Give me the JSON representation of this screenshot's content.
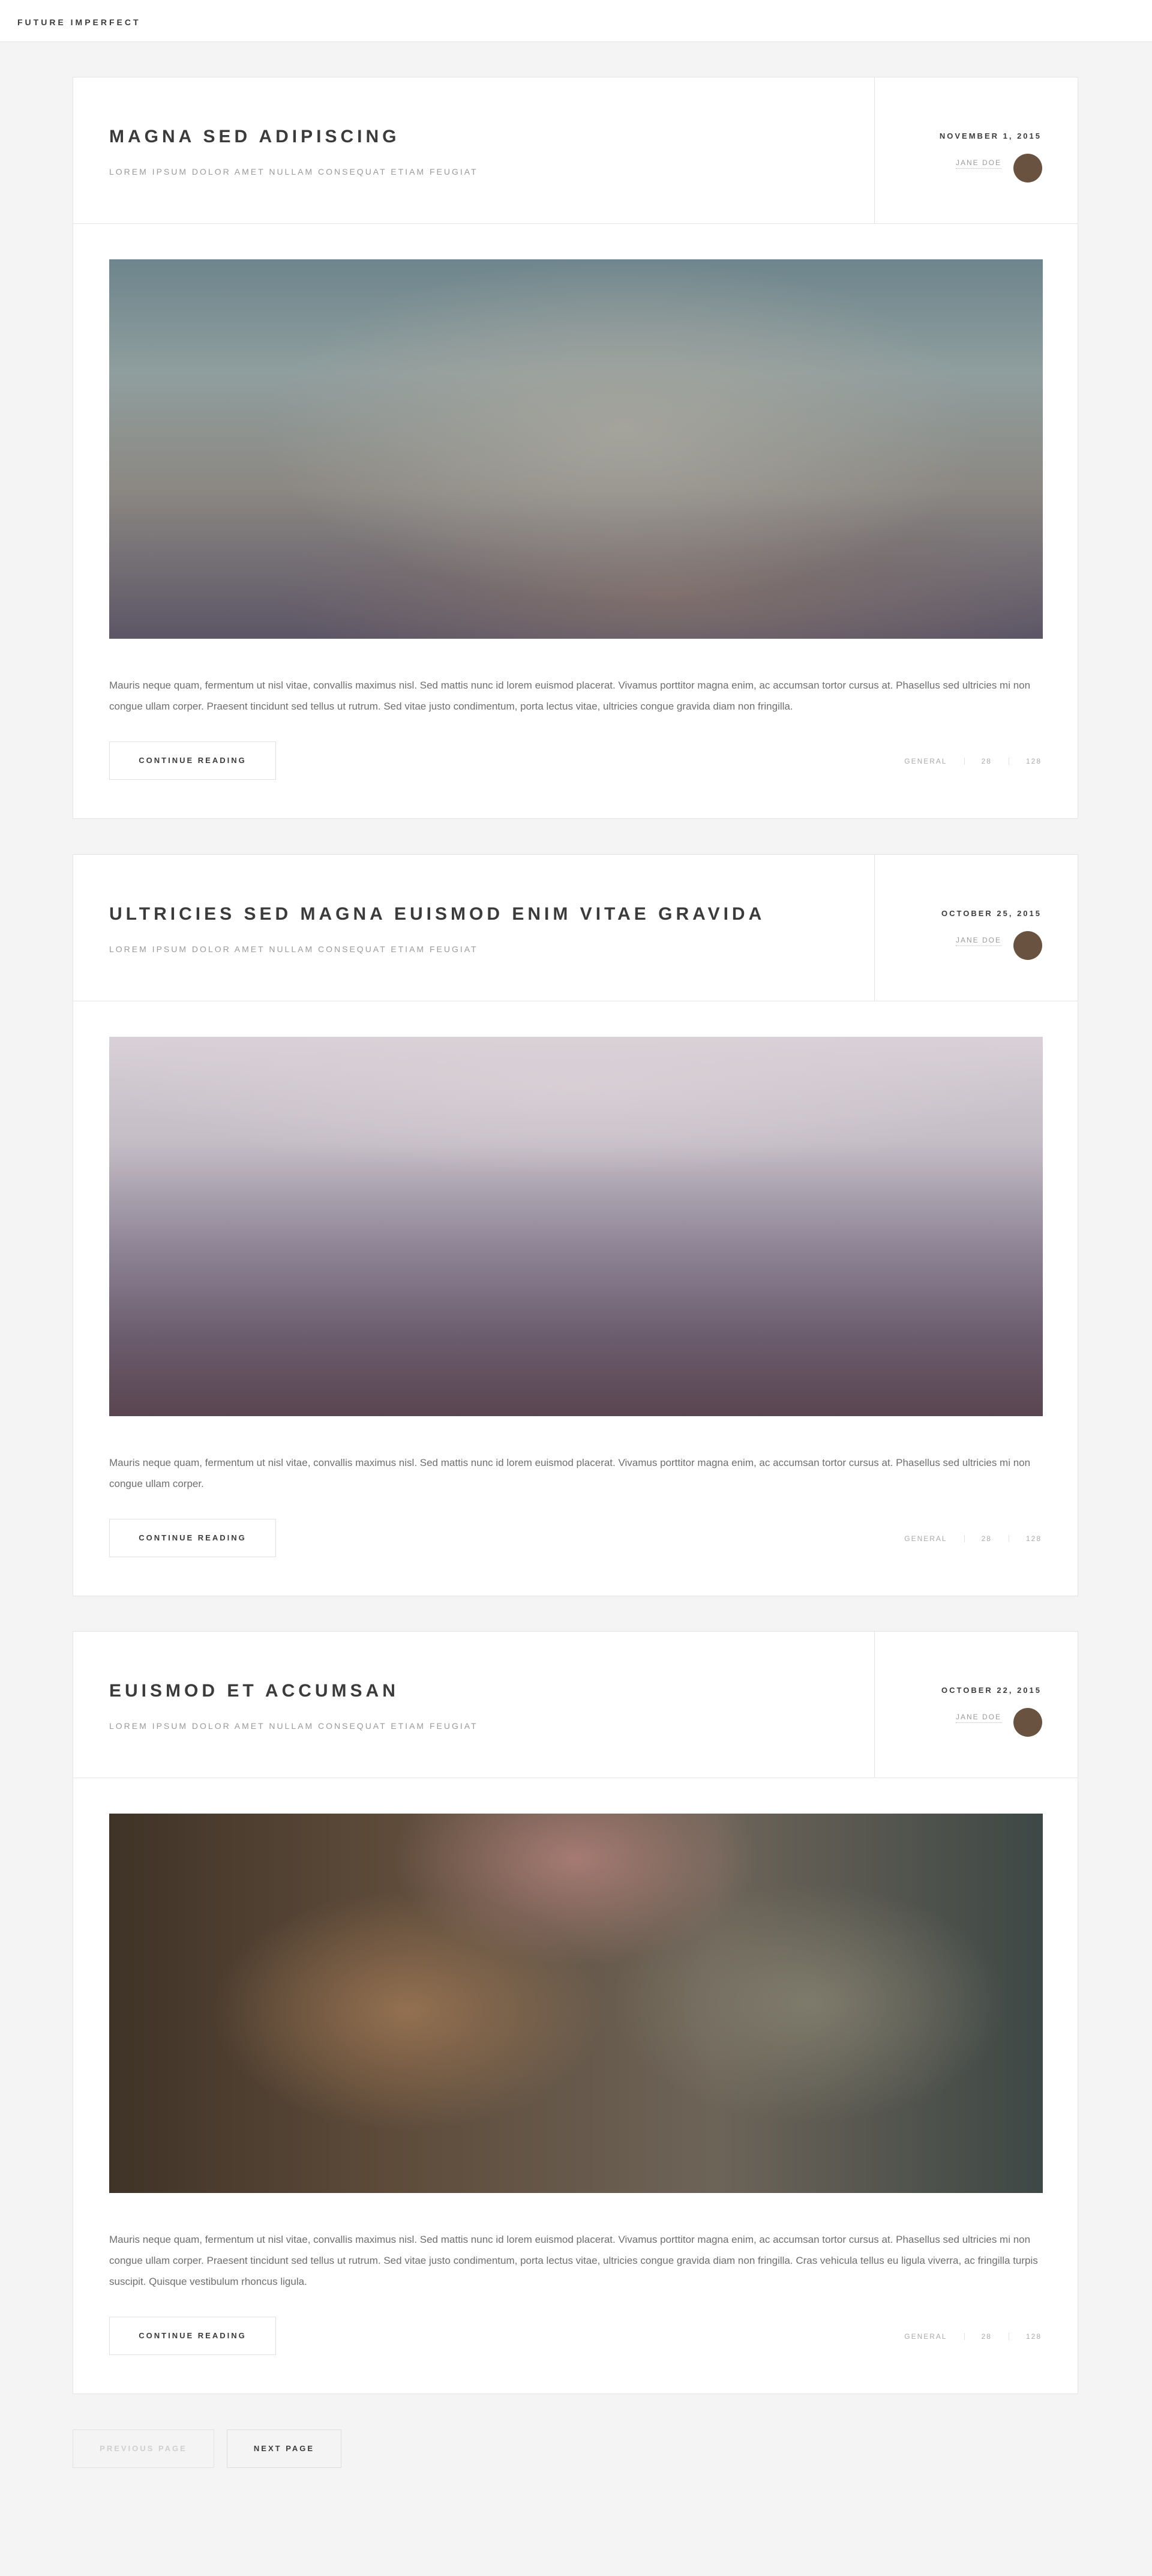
{
  "site": {
    "title": "FUTURE IMPERFECT"
  },
  "posts": [
    {
      "title": "MAGNA SED ADIPISCING",
      "subtitle": "LOREM IPSUM DOLOR AMET NULLAM CONSEQUAT ETIAM FEUGIAT",
      "date": "NOVEMBER 1, 2015",
      "author": "JANE DOE",
      "excerpt": "Mauris neque quam, fermentum ut nisl vitae, convallis maximus nisl. Sed mattis nunc id lorem euismod placerat. Vivamus porttitor magna enim, ac accumsan tortor cursus at. Phasellus sed ultricies mi non congue ullam corper. Praesent tincidunt sed tellus ut rutrum. Sed vitae justo condimentum, porta lectus vitae, ultricies congue gravida diam non fringilla.",
      "continue_label": "CONTINUE READING",
      "category": "GENERAL",
      "likes": "28",
      "comments": "128"
    },
    {
      "title": "ULTRICIES SED MAGNA EUISMOD ENIM VITAE GRAVIDA",
      "subtitle": "LOREM IPSUM DOLOR AMET NULLAM CONSEQUAT ETIAM FEUGIAT",
      "date": "OCTOBER 25, 2015",
      "author": "JANE DOE",
      "excerpt": "Mauris neque quam, fermentum ut nisl vitae, convallis maximus nisl. Sed mattis nunc id lorem euismod placerat. Vivamus porttitor magna enim, ac accumsan tortor cursus at. Phasellus sed ultricies mi non congue ullam corper.",
      "continue_label": "CONTINUE READING",
      "category": "GENERAL",
      "likes": "28",
      "comments": "128"
    },
    {
      "title": "EUISMOD ET ACCUMSAN",
      "subtitle": "LOREM IPSUM DOLOR AMET NULLAM CONSEQUAT ETIAM FEUGIAT",
      "date": "OCTOBER 22, 2015",
      "author": "JANE DOE",
      "excerpt": "Mauris neque quam, fermentum ut nisl vitae, convallis maximus nisl. Sed mattis nunc id lorem euismod placerat. Vivamus porttitor magna enim, ac accumsan tortor cursus at. Phasellus sed ultricies mi non congue ullam corper. Praesent tincidunt sed tellus ut rutrum. Sed vitae justo condimentum, porta lectus vitae, ultricies congue gravida diam non fringilla. Cras vehicula tellus eu ligula viverra, ac fringilla turpis suscipit. Quisque vestibulum rhoncus ligula.",
      "continue_label": "CONTINUE READING",
      "category": "GENERAL",
      "likes": "28",
      "comments": "128"
    }
  ],
  "pagination": {
    "previous_label": "PREVIOUS PAGE",
    "next_label": "NEXT PAGE"
  },
  "colors": {
    "page_background": "#f4f4f4",
    "card_background": "#ffffff",
    "text_dark": "#3c3b3b",
    "text_muted": "#9a9a9a",
    "avatar": "#6a5240"
  }
}
